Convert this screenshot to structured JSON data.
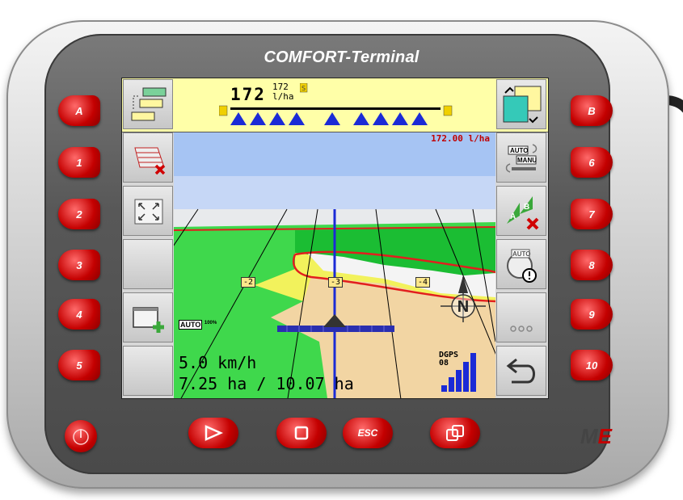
{
  "brand": {
    "title": "COMFORT-Terminal",
    "logo_text": "M",
    "logo_accent": "E"
  },
  "topbar": {
    "rate_value": "172",
    "rate_setpoint": "172",
    "rate_unit": "l/ha"
  },
  "map": {
    "applied_rate": "172.00 l/ha",
    "speed": "5.0 km/h",
    "area": "7.25 ha / 10.07 ha",
    "gps_mode": "DGPS",
    "gps_quality": "08",
    "auto_badge": "AUTO",
    "auto_percent": "100%",
    "track_labels": [
      "-2",
      "-3",
      "-4"
    ],
    "compass": "N",
    "signal_bars": 5
  },
  "softkeys_left": [
    {
      "name": "sk-headland-delete",
      "icon": "eraser-field-icon"
    },
    {
      "name": "sk-zoom-fit",
      "icon": "zoom-fit-icon"
    },
    {
      "name": "sk-empty-3",
      "icon": ""
    },
    {
      "name": "sk-add-window",
      "icon": "window-add-icon"
    },
    {
      "name": "sk-empty-5",
      "icon": ""
    }
  ],
  "softkeys_right": [
    {
      "name": "sk-auto-manual",
      "icon": "auto-manual-icon",
      "label_auto": "AUTO",
      "label_manu": "MANU"
    },
    {
      "name": "sk-delete-ab-line",
      "icon": "ab-line-delete-icon",
      "label_a": "A",
      "label_b": "B"
    },
    {
      "name": "sk-auto-warning",
      "icon": "auto-warning-icon",
      "label_auto": "AUTO"
    },
    {
      "name": "sk-more",
      "icon": "ellipsis-icon",
      "label": "ooo"
    },
    {
      "name": "sk-back",
      "icon": "back-arrow-icon"
    }
  ],
  "keys_left": [
    "A",
    "1",
    "2",
    "3",
    "4",
    "5"
  ],
  "keys_right": [
    "B",
    "6",
    "7",
    "8",
    "9",
    "10"
  ],
  "keys_bottom": {
    "esc_label": "ESC"
  },
  "colors": {
    "accent_red": "#c40000",
    "field_green": "#3fd84c",
    "topbar_yellow": "#ffffa8",
    "sky_blue": "#a6c4f3"
  }
}
